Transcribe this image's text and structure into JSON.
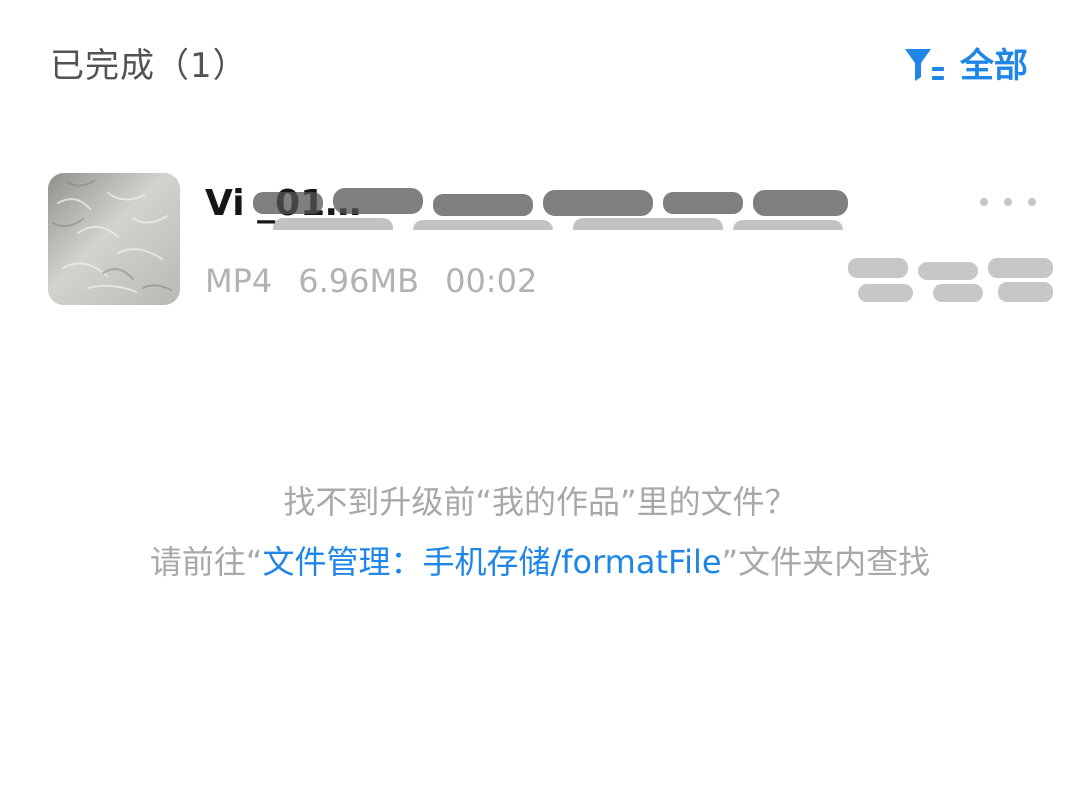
{
  "header": {
    "title": "已完成（1）",
    "filter_label": "全部",
    "accent_color": "#1f86e8"
  },
  "file_list": {
    "items": [
      {
        "name": "Vi                              _01…",
        "format": "MP4",
        "size": "6.96MB",
        "duration": "00:02",
        "thumbnail_icon": "video-thumbnail",
        "more_icon": "more-dots-icon"
      }
    ]
  },
  "hint": {
    "line1": "找不到升级前“我的作品”里的文件？",
    "line2_prefix": "请前往“",
    "line2_link": "文件管理：手机存储/formatFile",
    "line2_suffix": "”文件夹内查找"
  }
}
